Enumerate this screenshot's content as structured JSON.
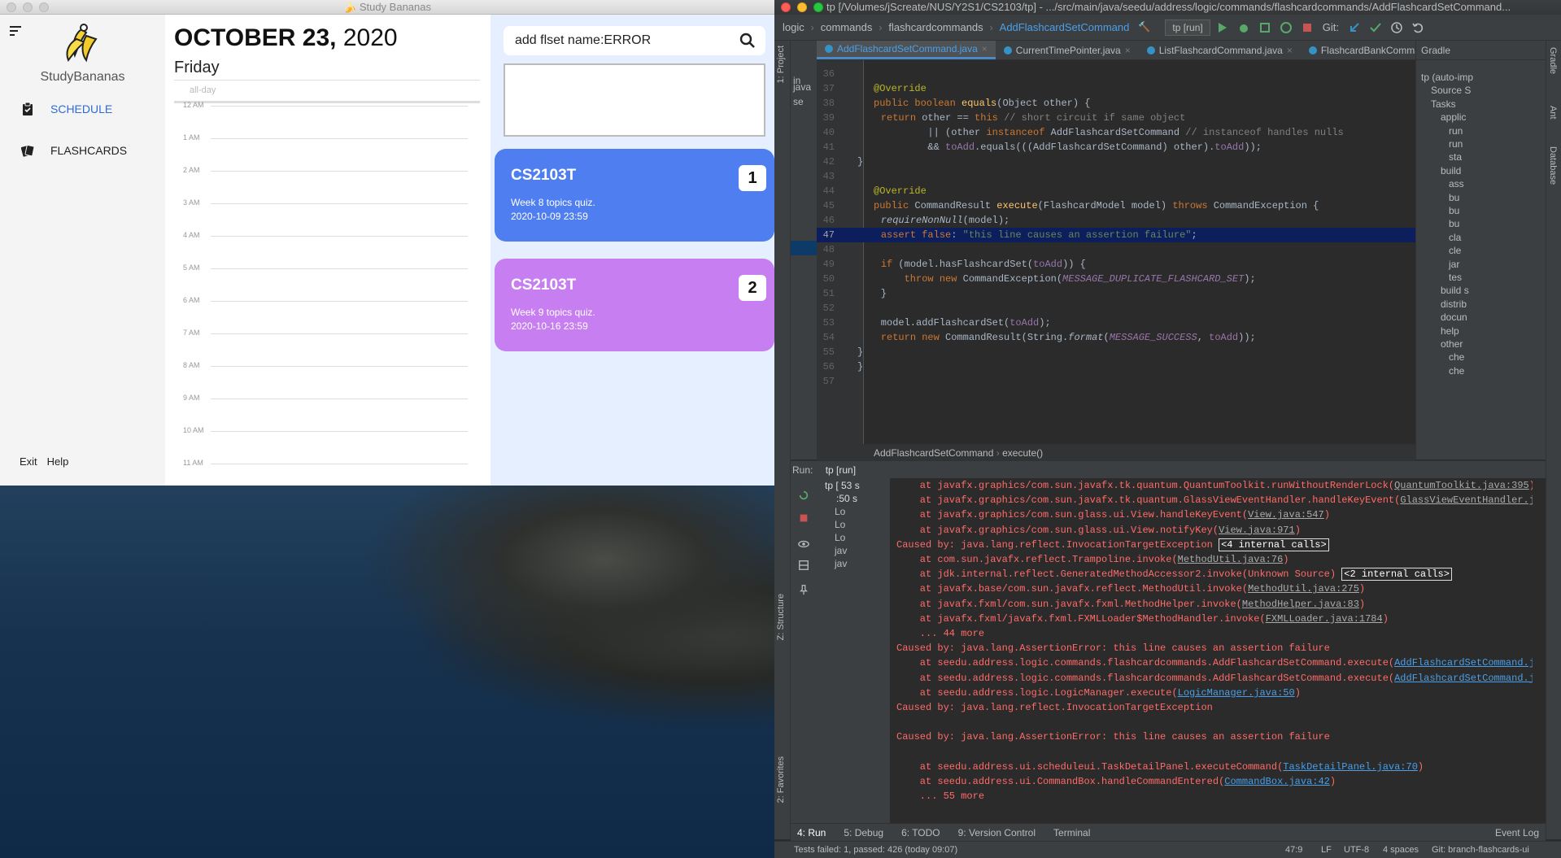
{
  "study_bananas": {
    "window_title": "Study Bananas",
    "app_name": "StudyBananas",
    "nav": [
      {
        "label": "SCHEDULE",
        "icon": "clipboard-icon"
      },
      {
        "label": "FLASHCARDS",
        "icon": "cards-icon"
      }
    ],
    "footer": {
      "exit": "Exit",
      "help": "Help"
    },
    "date_bold": "OCTOBER 23,",
    "date_year": " 2020",
    "weekday": "Friday",
    "allday": "all-day",
    "hours": [
      "12 AM",
      "1 AM",
      "2 AM",
      "3 AM",
      "4 AM",
      "5 AM",
      "6 AM",
      "7 AM",
      "8 AM",
      "9 AM",
      "10 AM",
      "11 AM"
    ],
    "search_value": "add flset name:ERROR",
    "tasks": [
      {
        "code": "CS2103T",
        "desc": "Week 8 topics quiz.",
        "due": "2020-10-09 23:59",
        "index": "1",
        "color": "#4f7ef0"
      },
      {
        "code": "CS2103T",
        "desc": "Week 9 topics quiz.",
        "due": "2020-10-16 23:59",
        "index": "2",
        "color": "#c77ef0"
      }
    ]
  },
  "ide": {
    "window_title": "tp [/Volumes/jScreate/NUS/Y2S1/CS2103/tp] - .../src/main/java/seedu/address/logic/commands/flashcardcommands/AddFlashcardSetCommand...",
    "breadcrumbs": [
      "logic",
      "commands",
      "flashcardcommands",
      "AddFlashcardSetCommand"
    ],
    "run_config": "tp [run]",
    "git_label": "Git:",
    "tabs": [
      "AddFlashcardSetCommand.java",
      "CurrentTimePointer.java",
      "ListFlashcardCommand.java",
      "FlashcardBankCommandTes"
    ],
    "gradle_title": "Gradle",
    "gradle_items": [
      "tp (auto-imp",
      "Source S",
      "Tasks",
      "applic",
      "run",
      "run",
      "sta",
      "build",
      "ass",
      "bu",
      "bu",
      "bu",
      "cla",
      "cle",
      "jar",
      "tes",
      "build s",
      "distrib",
      "docun",
      "help",
      "other",
      "che",
      "che"
    ],
    "code_lines": [
      {
        "no": "36",
        "html": ""
      },
      {
        "no": "37",
        "html": "<span class='ann'>@Override</span>"
      },
      {
        "no": "38",
        "html": "<span class='kw'>public boolean </span><span class='mth'>equals</span>(Object other) {"
      },
      {
        "no": "39",
        "html": "    <span class='kw'>return </span>other == <span class='kw'>this </span><span class='cmt'>// short circuit if same object</span>"
      },
      {
        "no": "40",
        "html": "            || (other <span class='kw'>instanceof </span>AddFlashcardSetCommand <span class='cmt'>// instanceof handles nulls</span>"
      },
      {
        "no": "41",
        "html": "            && <span class='fld'>toAdd</span>.equals(((AddFlashcardSetCommand) other).<span class='fld'>toAdd</span>));"
      },
      {
        "no": "42",
        "html": "}"
      },
      {
        "no": "43",
        "html": ""
      },
      {
        "no": "44",
        "html": "<span class='ann'>@Override</span>"
      },
      {
        "no": "45",
        "html": "<span class='kw'>public </span>CommandResult <span class='mth'>execute</span>(FlashcardModel model) <span class='kw'>throws </span>CommandException {"
      },
      {
        "no": "46",
        "html": "    <span class='it'>requireNonNull</span>(model);"
      },
      {
        "no": "47",
        "html": "    <span class='kw'>assert false</span>: <span class='str'>\"this line causes an assertion failure\"</span>;"
      },
      {
        "no": "48",
        "html": ""
      },
      {
        "no": "49",
        "html": "    <span class='kw'>if </span>(model.hasFlashcardSet(<span class='fld'>toAdd</span>)) {"
      },
      {
        "no": "50",
        "html": "        <span class='kw'>throw new </span>CommandException(<span class='fld it'>MESSAGE_DUPLICATE_FLASHCARD_SET</span>);"
      },
      {
        "no": "51",
        "html": "    }"
      },
      {
        "no": "52",
        "html": ""
      },
      {
        "no": "53",
        "html": "    model.addFlashcardSet(<span class='fld'>toAdd</span>);"
      },
      {
        "no": "54",
        "html": "    <span class='kw'>return new </span>CommandResult(String.<span class='it'>format</span>(<span class='fld it'>MESSAGE_SUCCESS</span>, <span class='fld'>toAdd</span>));"
      },
      {
        "no": "55",
        "html": "}"
      },
      {
        "no": "56",
        "html": "}"
      },
      {
        "no": "57",
        "html": ""
      }
    ],
    "editor_crumbs": [
      "AddFlashcardSetCommand",
      "execute()"
    ],
    "run_label": "Run:",
    "run_tab": "tp [run]",
    "run_tree": [
      "tp [ 53 s",
      ":50 s",
      "Lo",
      "Lo",
      "Lo",
      "jav",
      "jav"
    ],
    "console_lines": [
      "    at javafx.graphics/com.sun.javafx.tk.quantum.QuantumToolkit.runWithoutRenderLock(<span class='lk'>QuantumToolkit.java:395</span>)",
      "    at javafx.graphics/com.sun.javafx.tk.quantum.GlassViewEventHandler.handleKeyEvent(<span class='lk'>GlassViewEventHandler.java</span>",
      "    at javafx.graphics/com.sun.glass.ui.View.handleKeyEvent(<span class='lk'>View.java:547</span>)",
      "    at javafx.graphics/com.sun.glass.ui.View.notifyKey(<span class='lk'>View.java:971</span>)",
      "Caused by: java.lang.reflect.InvocationTargetException <span class='box'>&lt;4 internal calls&gt;</span>",
      "    at com.sun.javafx.reflect.Trampoline.invoke(<span class='lk'>MethodUtil.java:76</span>)",
      "    at jdk.internal.reflect.GeneratedMethodAccessor2.invoke(Unknown Source) <span class='box'>&lt;2 internal calls&gt;</span>",
      "    at javafx.base/com.sun.javafx.reflect.MethodUtil.invoke(<span class='lk'>MethodUtil.java:275</span>)",
      "    at javafx.fxml/com.sun.javafx.fxml.MethodHelper.invoke(<span class='lk'>MethodHelper.java:83</span>)",
      "    at javafx.fxml/javafx.fxml.FXMLLoader$MethodHandler.invoke(<span class='lk'>FXMLLoader.java:1784</span>)",
      "    ... 44 more",
      "Caused by: java.lang.AssertionError: this line causes an assertion failure",
      "    at seedu.address.logic.commands.flashcardcommands.AddFlashcardSetCommand.execute(<a>AddFlashcardSetCommand.java</a>",
      "    at seedu.address.logic.commands.flashcardcommands.AddFlashcardSetCommand.execute(<a>AddFlashcardSetCommand.java</a>",
      "    at seedu.address.logic.LogicManager.execute(<a>LogicManager.java:50</a>)",
      "Caused by: java.lang.reflect.InvocationTargetException",
      "",
      "Caused by: java.lang.AssertionError: this line causes an assertion failure",
      "",
      "    at seedu.address.ui.scheduleui.TaskDetailPanel.executeCommand(<a>TaskDetailPanel.java:70</a>)",
      "    at seedu.address.ui.CommandBox.handleCommandEntered(<a>CommandBox.java:42</a>)",
      "    ... 55 more"
    ],
    "bottom_tabs": [
      "4: Run",
      "5: Debug",
      "6: TODO",
      "9: Version Control",
      "Terminal"
    ],
    "event_log": "Event Log",
    "status_left": "Tests failed: 1, passed: 426 (today 09:07)",
    "status_pos": "47:9",
    "status_lf": "LF",
    "status_enc": "UTF-8",
    "status_indent": "4 spaces",
    "status_git": "Git: branch-flashcards-ui",
    "left_vtabs": [
      "1: Project",
      "Z: Structure",
      "2: Favorites"
    ],
    "right_vtabs": [
      "Gradle",
      "Ant",
      "Database"
    ]
  }
}
